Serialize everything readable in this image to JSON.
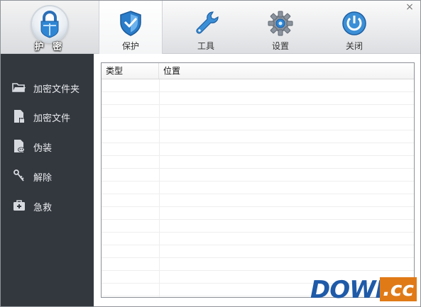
{
  "app": {
    "logo_text": "护 密"
  },
  "tabs": [
    {
      "label": "保护",
      "icon": "shield-icon",
      "active": true
    },
    {
      "label": "工具",
      "icon": "wrench-icon",
      "active": false
    },
    {
      "label": "设置",
      "icon": "gear-icon",
      "active": false
    },
    {
      "label": "关闭",
      "icon": "power-icon",
      "active": false
    }
  ],
  "window": {
    "close_glyph": "×"
  },
  "sidebar": {
    "items": [
      {
        "label": "加密文件夹",
        "icon": "folder-icon"
      },
      {
        "label": "加密文件",
        "icon": "file-lock-icon"
      },
      {
        "label": "伪装",
        "icon": "mask-file-icon"
      },
      {
        "label": "解除",
        "icon": "unlock-key-icon"
      },
      {
        "label": "急救",
        "icon": "first-aid-icon"
      }
    ]
  },
  "table": {
    "columns": [
      "类型",
      "位置"
    ],
    "rows": []
  },
  "watermark": {
    "text_main": "DOWN",
    "text_suffix": ".cc"
  },
  "colors": {
    "sidebar_bg": "#33383f",
    "accent_blue": "#2a78c8",
    "watermark_orange": "#e07a17"
  }
}
